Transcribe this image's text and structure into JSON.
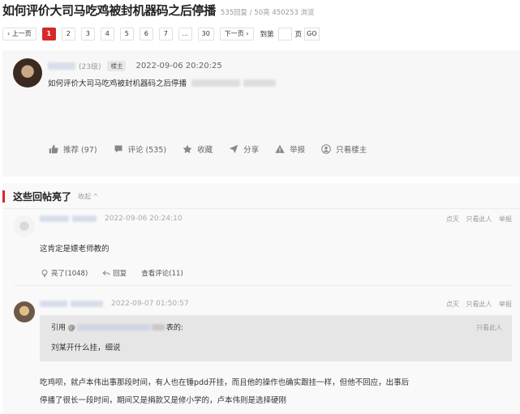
{
  "thread": {
    "title": "如何评价大司马吃鸡被封机器码之后停播",
    "stats": "535回复 / 50亮 450253 浏览"
  },
  "pager": {
    "prev": "‹ 上一页",
    "pages": [
      "1",
      "2",
      "3",
      "4",
      "5",
      "6",
      "7",
      "...",
      "30"
    ],
    "next": "下一页 ›",
    "goto_label": "到第",
    "unit": "页",
    "go": "GO"
  },
  "main_post": {
    "level": "(23级)",
    "badge": "楼主",
    "time": "2022-09-06 20:20:25",
    "body": "如何评价大司马吃鸡被封机器码之后停播",
    "actions": {
      "recommend": "推荐 (97)",
      "comment": "评论 (535)",
      "collect": "收藏",
      "share": "分享",
      "report": "举报",
      "only_op": "只看楼主"
    }
  },
  "hot": {
    "title": "这些回帖亮了",
    "collapse": "收起 ^"
  },
  "replies": [
    {
      "time": "2022-09-06 20:24:10",
      "ops": [
        "点灭",
        "只看此人",
        "举报"
      ],
      "text": "这肯定是嫖老师教的",
      "actions": {
        "light": "亮了(1048)",
        "reply": "回复",
        "view": "查看评论(11)"
      }
    },
    {
      "time": "2022-09-07 01:50:57",
      "ops": [
        "点灭",
        "只看此人",
        "举报"
      ],
      "quote": {
        "prefix": "引用 @",
        "suffix": "表的:",
        "only": "只看此人",
        "text": "刘某开什么挂，细说"
      },
      "text_line1": "吃鸡呗，就卢本伟出事那段时间，有人也在锤pdd开挂，而且他的操作也确实跟挂一样，但他不回应，出事后",
      "text_line2": "停播了很长一段时间，期间又是捐款又是修小学的，卢本伟则是选择硬刚"
    }
  ]
}
